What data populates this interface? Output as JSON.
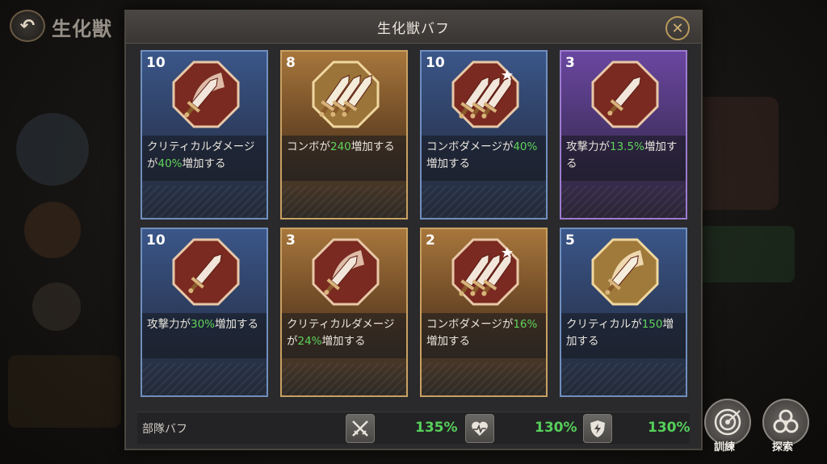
{
  "background": {
    "back_icon": "back-arrow-icon",
    "title": "生化獣"
  },
  "panel": {
    "title": "生化獣バフ",
    "close_icon": "close-x-icon"
  },
  "cards": [
    {
      "level": "10",
      "theme": "blue",
      "icon": "crit-damage-icon",
      "pre": "クリティカルダメージが",
      "value": "40%",
      "post": "増加する"
    },
    {
      "level": "8",
      "theme": "blue",
      "icon": "combo-icon",
      "pre": "コンボが",
      "value": "240",
      "post": "増加する"
    },
    {
      "level": "10",
      "theme": "blue",
      "icon": "combo-damage-icon",
      "pre": "コンボダメージが",
      "value": "40%",
      "post": "増加する"
    },
    {
      "level": "3",
      "theme": "purple",
      "icon": "attack-icon",
      "pre": "攻撃力が",
      "value": "13.5%",
      "post": "増加する"
    },
    {
      "level": "10",
      "theme": "blue",
      "icon": "attack-icon",
      "pre": "攻撃力が",
      "value": "30%",
      "post": "増加する"
    },
    {
      "level": "3",
      "theme": "gold",
      "icon": "crit-damage-icon",
      "pre": "クリティカルダメージが",
      "value": "24%",
      "post": "増加する"
    },
    {
      "level": "2",
      "theme": "gold",
      "icon": "combo-damage-icon",
      "pre": "コンボダメージが",
      "value": "16%",
      "post": "増加する"
    },
    {
      "level": "5",
      "theme": "blue",
      "icon": "critical-icon",
      "pre": "クリティカルが",
      "value": "150",
      "post": "増加する"
    }
  ],
  "footer": {
    "label": "部隊バフ",
    "stats": [
      {
        "icon": "crossed-swords-icon",
        "value": "135%"
      },
      {
        "icon": "heart-plus-icon",
        "value": "130%"
      },
      {
        "icon": "shield-bolt-icon",
        "value": "130%"
      }
    ]
  },
  "side_buttons": [
    {
      "icon": "target-icon",
      "label": "訓練"
    },
    {
      "icon": "biohazard-icon",
      "label": "探索"
    }
  ],
  "colors": {
    "highlight": "#5fd35a",
    "card_blue": "#3b5689",
    "card_gold": "#a7763c",
    "card_purple": "#6a47a0",
    "icon_red": "#7a2a20"
  }
}
